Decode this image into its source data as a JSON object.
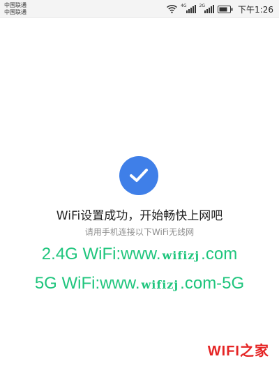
{
  "status_bar": {
    "carrier_1": "中国联通",
    "carrier_2": "中国联通",
    "network_1": "4G",
    "network_2": "2G",
    "time": "下午1:26"
  },
  "content": {
    "title": "WiFi设置成功，开始畅快上网吧",
    "subtitle": "请用手机连接以下WiFi无线网",
    "wifi_24g": {
      "prefix": "2.4G WiFi:www.",
      "mark": "wifizj",
      "suffix": ".com"
    },
    "wifi_5g": {
      "prefix": "5G WiFi:www.",
      "mark": "wifizj",
      "suffix": ".com-5G"
    }
  },
  "watermark": "WIFI之家",
  "colors": {
    "accent_blue": "#3f7fe8",
    "wifi_green": "#1fc57d",
    "watermark_red": "#e52424"
  },
  "icons": [
    "wifi-icon",
    "signal-icon",
    "battery-icon",
    "check-icon"
  ]
}
